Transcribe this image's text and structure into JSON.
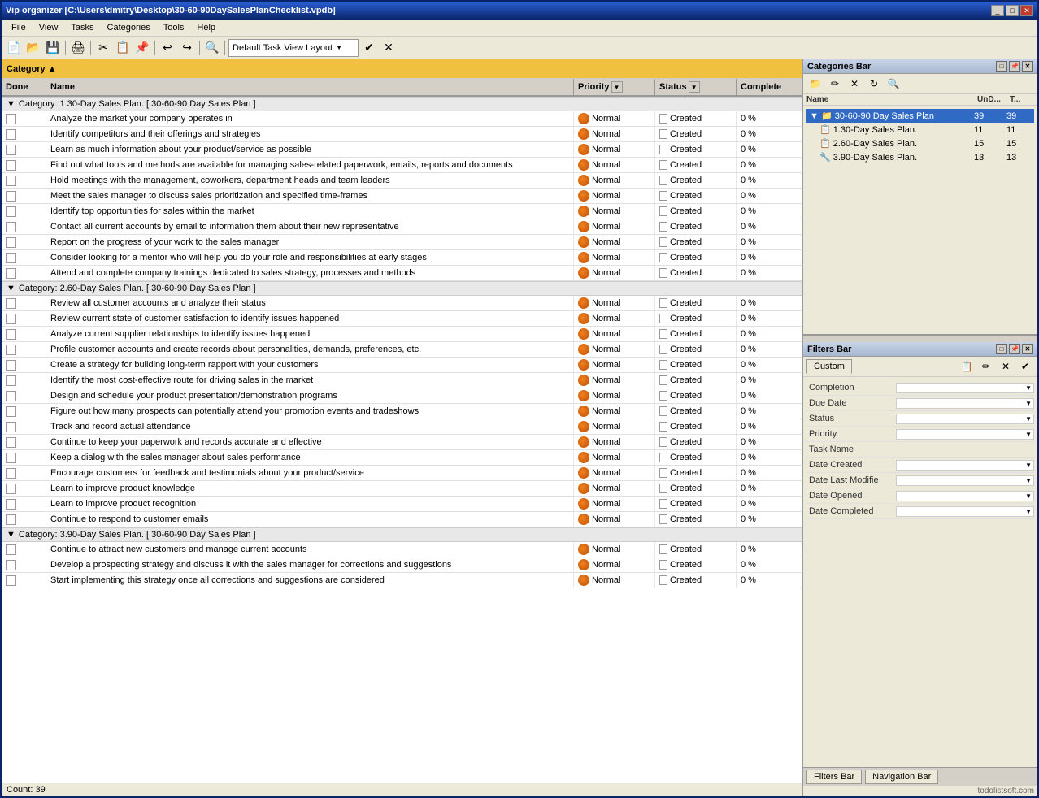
{
  "window": {
    "title": "Vip organizer [C:\\Users\\dmitry\\Desktop\\30-60-90DaySalesPlanChecklist.vpdb]",
    "btns": [
      "_",
      "□",
      "✕"
    ]
  },
  "menu": {
    "items": [
      "File",
      "View",
      "Tasks",
      "Categories",
      "Tools",
      "Help"
    ]
  },
  "toolbar": {
    "layout_label": "Default Task View Layout"
  },
  "category_header": {
    "text": "Category",
    "sort_arrow": "▲"
  },
  "table": {
    "headers": [
      "Done",
      "Name",
      "Priority",
      "Status",
      "Complete"
    ]
  },
  "categories": [
    {
      "id": "cat1",
      "label": "Category: 1.30-Day Sales Plan.    [ 30-60-90 Day Sales Plan ]",
      "tasks": [
        {
          "done": false,
          "name": "Analyze the market your company operates in",
          "priority": "Normal",
          "status": "Created",
          "complete": "0 %"
        },
        {
          "done": false,
          "name": "Identify competitors and their offerings and strategies",
          "priority": "Normal",
          "status": "Created",
          "complete": "0 %"
        },
        {
          "done": false,
          "name": "Learn as much information about your product/service as possible",
          "priority": "Normal",
          "status": "Created",
          "complete": "0 %"
        },
        {
          "done": false,
          "name": "Find out what tools and methods are available for managing sales-related paperwork, emails, reports and documents",
          "priority": "Normal",
          "status": "Created",
          "complete": "0 %"
        },
        {
          "done": false,
          "name": "Hold meetings with the management, coworkers, department heads and team leaders",
          "priority": "Normal",
          "status": "Created",
          "complete": "0 %"
        },
        {
          "done": false,
          "name": "Meet the sales manager to discuss sales prioritization and specified time-frames",
          "priority": "Normal",
          "status": "Created",
          "complete": "0 %"
        },
        {
          "done": false,
          "name": "Identify top  opportunities for sales within the market",
          "priority": "Normal",
          "status": "Created",
          "complete": "0 %"
        },
        {
          "done": false,
          "name": "Contact all current accounts by email to information them about their new representative",
          "priority": "Normal",
          "status": "Created",
          "complete": "0 %"
        },
        {
          "done": false,
          "name": "Report on the progress of your work to the sales manager",
          "priority": "Normal",
          "status": "Created",
          "complete": "0 %"
        },
        {
          "done": false,
          "name": "Consider looking for a mentor who will help you do your role and responsibilities at early stages",
          "priority": "Normal",
          "status": "Created",
          "complete": "0 %"
        },
        {
          "done": false,
          "name": "Attend and complete company trainings dedicated to sales strategy, processes and methods",
          "priority": "Normal",
          "status": "Created",
          "complete": "0 %"
        }
      ]
    },
    {
      "id": "cat2",
      "label": "Category: 2.60-Day Sales Plan.    [ 30-60-90 Day Sales Plan ]",
      "tasks": [
        {
          "done": false,
          "name": "Review all  customer accounts and analyze their status",
          "priority": "Normal",
          "status": "Created",
          "complete": "0 %"
        },
        {
          "done": false,
          "name": "Review current state of customer satisfaction  to identify issues happened",
          "priority": "Normal",
          "status": "Created",
          "complete": "0 %"
        },
        {
          "done": false,
          "name": "Analyze current supplier relationships to identify issues happened",
          "priority": "Normal",
          "status": "Created",
          "complete": "0 %"
        },
        {
          "done": false,
          "name": "Profile customer accounts and create records about personalities, demands, preferences, etc.",
          "priority": "Normal",
          "status": "Created",
          "complete": "0 %"
        },
        {
          "done": false,
          "name": "Create a strategy for building long-term rapport with your customers",
          "priority": "Normal",
          "status": "Created",
          "complete": "0 %"
        },
        {
          "done": false,
          "name": "Identify the most cost-effective route for driving sales in the market",
          "priority": "Normal",
          "status": "Created",
          "complete": "0 %"
        },
        {
          "done": false,
          "name": "Design and schedule your product presentation/demonstration programs",
          "priority": "Normal",
          "status": "Created",
          "complete": "0 %"
        },
        {
          "done": false,
          "name": "Figure out how many prospects can potentially attend your promotion events and tradeshows",
          "priority": "Normal",
          "status": "Created",
          "complete": "0 %"
        },
        {
          "done": false,
          "name": "Track and record actual attendance",
          "priority": "Normal",
          "status": "Created",
          "complete": "0 %"
        },
        {
          "done": false,
          "name": "Continue to keep your paperwork and records accurate and effective",
          "priority": "Normal",
          "status": "Created",
          "complete": "0 %"
        },
        {
          "done": false,
          "name": "Keep a dialog with the sales manager about sales performance",
          "priority": "Normal",
          "status": "Created",
          "complete": "0 %"
        },
        {
          "done": false,
          "name": "Encourage customers for feedback and testimonials about your product/service",
          "priority": "Normal",
          "status": "Created",
          "complete": "0 %"
        },
        {
          "done": false,
          "name": "Learn to improve product knowledge",
          "priority": "Normal",
          "status": "Created",
          "complete": "0 %"
        },
        {
          "done": false,
          "name": "Learn to improve product recognition",
          "priority": "Normal",
          "status": "Created",
          "complete": "0 %"
        },
        {
          "done": false,
          "name": "Continue to respond to customer emails",
          "priority": "Normal",
          "status": "Created",
          "complete": "0 %"
        }
      ]
    },
    {
      "id": "cat3",
      "label": "Category: 3.90-Day Sales Plan.    [ 30-60-90 Day Sales Plan ]",
      "tasks": [
        {
          "done": false,
          "name": "Continue to attract new customers and manage current accounts",
          "priority": "Normal",
          "status": "Created",
          "complete": "0 %"
        },
        {
          "done": false,
          "name": "Develop a prospecting strategy and discuss it with the sales manager for corrections and suggestions",
          "priority": "Normal",
          "status": "Created",
          "complete": "0 %"
        },
        {
          "done": false,
          "name": "Start implementing this strategy once all corrections and suggestions are considered",
          "priority": "Normal",
          "status": "Created",
          "complete": "0 %"
        }
      ]
    }
  ],
  "count_bar": {
    "text": "Count: 39"
  },
  "right_panel": {
    "categories_bar": {
      "title": "Categories Bar",
      "tree_header": {
        "name": "Name",
        "undone": "UnD...",
        "total": "T..."
      },
      "tree_items": [
        {
          "label": "30-60-90 Day Sales Plan",
          "undone": "39",
          "total": "39",
          "level": 0,
          "expanded": true
        },
        {
          "label": "1.30-Day Sales Plan.",
          "undone": "11",
          "total": "11",
          "level": 1
        },
        {
          "label": "2.60-Day Sales Plan.",
          "undone": "15",
          "total": "15",
          "level": 1
        },
        {
          "label": "3.90-Day Sales Plan.",
          "undone": "13",
          "total": "13",
          "level": 1
        }
      ]
    },
    "filters_bar": {
      "title": "Filters Bar",
      "tabs": [
        "Custom"
      ],
      "filters": [
        {
          "label": "Completion",
          "has_dropdown": true
        },
        {
          "label": "Due Date",
          "has_dropdown": true
        },
        {
          "label": "Status",
          "has_dropdown": true
        },
        {
          "label": "Priority",
          "has_dropdown": true
        },
        {
          "label": "Task Name",
          "has_dropdown": false
        },
        {
          "label": "Date Created",
          "has_dropdown": true
        },
        {
          "label": "Date Last Modifie",
          "has_dropdown": true
        },
        {
          "label": "Date Opened",
          "has_dropdown": true
        },
        {
          "label": "Date Completed",
          "has_dropdown": true
        }
      ]
    },
    "bottom_tabs": [
      "Filters Bar",
      "Navigation Bar"
    ]
  },
  "watermark": "todolistsoft.com"
}
